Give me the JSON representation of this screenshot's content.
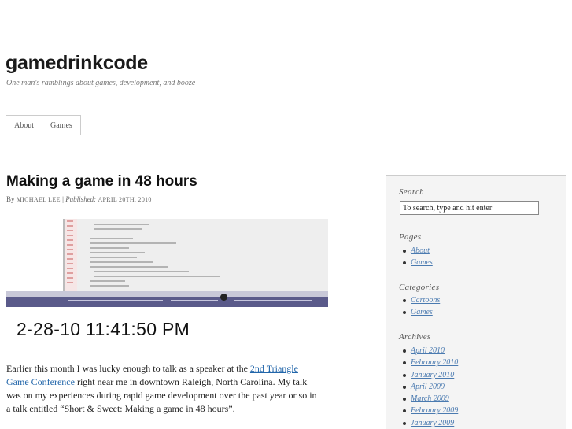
{
  "site": {
    "title": "gamedrinkcode",
    "tagline": "One man's ramblings about games, development, and booze"
  },
  "nav": {
    "items": [
      "About",
      "Games"
    ]
  },
  "post": {
    "title": "Making a game in 48 hours",
    "byline_by": "By",
    "author": "Michael Lee",
    "separator": "|",
    "published_label": "Published:",
    "date": "April 20th, 2010",
    "image_timestamp": "2-28-10 11:41:50 PM",
    "body_before_link": "Earlier this month I was lucky enough to talk as a speaker at the ",
    "body_link": "2nd Triangle Game Conference",
    "body_after_link": " right near me in downtown Raleigh, North Carolina. My talk was on my experiences during rapid game development over the past year or so in a talk entitled “Short & Sweet: Making a game in 48 hours”."
  },
  "sidebar": {
    "search": {
      "heading": "Search",
      "value": "To search, type and hit enter"
    },
    "pages": {
      "heading": "Pages",
      "items": [
        "About",
        "Games"
      ]
    },
    "categories": {
      "heading": "Categories",
      "items": [
        "Cartoons",
        "Games"
      ]
    },
    "archives": {
      "heading": "Archives",
      "items": [
        "April 2010",
        "February 2010",
        "January 2010",
        "April 2009",
        "March 2009",
        "February 2009",
        "January 2009"
      ]
    }
  },
  "colors": {
    "link": "#2266aa",
    "sidebar_link": "#4a7ab0",
    "sidebar_bg": "#f4f4f4",
    "border": "#cccccc"
  }
}
